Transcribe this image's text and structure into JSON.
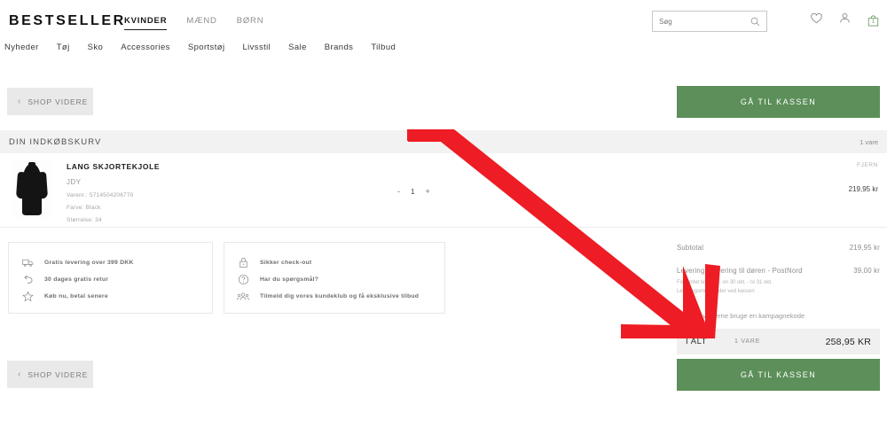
{
  "header": {
    "brand": "BESTSELLER",
    "top_nav": [
      {
        "label": "KVINDER",
        "active": true
      },
      {
        "label": "MÆND",
        "active": false
      },
      {
        "label": "BØRN",
        "active": false
      }
    ],
    "main_nav": [
      {
        "label": "Nyheder"
      },
      {
        "label": "Tøj"
      },
      {
        "label": "Sko"
      },
      {
        "label": "Accessories"
      },
      {
        "label": "Sportstøj"
      },
      {
        "label": "Livsstil"
      },
      {
        "label": "Sale"
      },
      {
        "label": "Brands"
      },
      {
        "label": "Tilbud"
      }
    ],
    "search": {
      "placeholder": "Søg",
      "value": "",
      "icon": "search-icon"
    },
    "icons": {
      "wishlist": "heart-icon",
      "account": "person-icon",
      "bag": "shopping-bag-icon",
      "bag_count": "1"
    }
  },
  "actions": {
    "shop_videre_label": "SHOP VIDERE",
    "shop_videre_chevron": "‹",
    "checkout_label": "GÅ TIL KASSEN"
  },
  "cart": {
    "title": "DIN INDKØBSKURV",
    "count": "1 vare",
    "item": {
      "name": "LANG SKJORTEKJOLE",
      "brand": "JDY",
      "item_number": "Varenr.: 5714504206770",
      "color": "Farve: Black",
      "size": "Størrelse: 34",
      "remove_label": "FJERN",
      "qty_minus": "-",
      "qty_value": "1",
      "qty_plus": "+",
      "price": "219,95 kr"
    }
  },
  "benefits": {
    "box1": [
      {
        "icon": "truck-icon",
        "label": "Gratis levering over 399 DKK"
      },
      {
        "icon": "return-arrow-icon",
        "label": "30 dages gratis retur"
      },
      {
        "icon": "star-icon",
        "label": "Køb nu, betal senere"
      }
    ],
    "box2": [
      {
        "icon": "lock-icon",
        "label": "Sikker check-out"
      },
      {
        "icon": "question-circle-icon",
        "label": "Har du spørgsmål?"
      },
      {
        "icon": "people-icon",
        "label": "Tilmeld dig vores kundeklub og få eksklusive tilbud"
      }
    ]
  },
  "summary": {
    "subtotal_label": "Subtotal",
    "subtotal_value": "219,95 kr",
    "delivery_label": "Levering: Levering til døren - PostNord",
    "delivery_value": "39,00 kr",
    "delivery_note_1": "Forventet levering: on 30 okt. - to 31 okt.",
    "delivery_note_2": "Leveringsmuligheder ved kassen",
    "promo_label": "Jeg vil gerne bruge en kampagnekode",
    "promo_checked": false,
    "total_label": "I ALT",
    "total_qty": "1 VARE",
    "total_amount": "258,95 KR"
  },
  "annotation": {
    "type": "red-arrow",
    "color": "#ee1c24",
    "points_to": "promo-code-checkbox"
  },
  "colors": {
    "accent_green": "#5c8f59",
    "annotation_red": "#ee1c24",
    "bar_gray": "#f2f2f2",
    "button_gray": "#e9e9e9"
  }
}
